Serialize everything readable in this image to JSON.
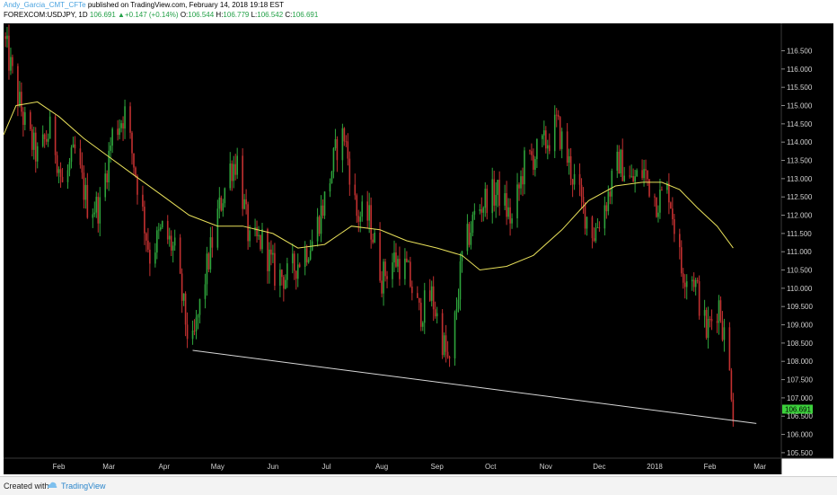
{
  "header": {
    "author": "Andy_Garcia_CMT_CFTe",
    "published": " published on TradingView.com, February 14, 2018 19:18 EST",
    "symbol": "FOREXCOM:USDJPY, 1D",
    "last": "106.691",
    "change": "+0.147 (+0.14%)",
    "o_label": "O:",
    "o_value": "106.544",
    "h_label": "H:",
    "h_value": "106.779",
    "l_label": "L:",
    "l_value": "106.542",
    "c_label": "C:",
    "c_value": "106.691"
  },
  "footer": {
    "created": "Created with",
    "brand": "TradingView"
  },
  "colors": {
    "background": "#000000",
    "up_candle": "#2ea43c",
    "down_candle": "#c23030",
    "moving_average": "#e8e05a",
    "trendline": "#d8d8d8",
    "price_tag": "#3cd13c"
  },
  "chart_data": {
    "type": "candlestick",
    "symbol": "USDJPY",
    "interval": "1D",
    "x_axis_labels": [
      "Feb",
      "Mar",
      "Apr",
      "May",
      "Jun",
      "Jul",
      "Aug",
      "Sep",
      "Oct",
      "Nov",
      "Dec",
      "2018",
      "Feb",
      "Mar"
    ],
    "y_axis_labels": [
      "116.500",
      "116.000",
      "115.500",
      "115.000",
      "114.500",
      "114.000",
      "113.500",
      "113.000",
      "112.500",
      "112.000",
      "111.500",
      "111.000",
      "110.500",
      "110.000",
      "109.500",
      "109.000",
      "108.500",
      "108.000",
      "107.500",
      "107.000",
      "106.500",
      "106.000",
      "105.500"
    ],
    "ylim": [
      105.35,
      117.25
    ],
    "last_price": "106.691",
    "close_path": [
      [
        "2017-01-01",
        116.9
      ],
      [
        "2017-01-07",
        115.6
      ],
      [
        "2017-01-14",
        114.3
      ],
      [
        "2017-01-20",
        113.6
      ],
      [
        "2017-01-28",
        114.4
      ],
      [
        "2017-02-03",
        112.8
      ],
      [
        "2017-02-10",
        113.7
      ],
      [
        "2017-02-17",
        112.3
      ],
      [
        "2017-02-24",
        112.2
      ],
      [
        "2017-03-03",
        114.2
      ],
      [
        "2017-03-10",
        114.8
      ],
      [
        "2017-03-17",
        112.9
      ],
      [
        "2017-03-24",
        110.9
      ],
      [
        "2017-03-31",
        111.6
      ],
      [
        "2017-04-07",
        111.0
      ],
      [
        "2017-04-14",
        108.8
      ],
      [
        "2017-04-17",
        108.4
      ],
      [
        "2017-04-24",
        110.3
      ],
      [
        "2017-05-01",
        112.0
      ],
      [
        "2017-05-08",
        113.3
      ],
      [
        "2017-05-12",
        113.5
      ],
      [
        "2017-05-19",
        111.2
      ],
      [
        "2017-05-26",
        111.3
      ],
      [
        "2017-06-02",
        110.4
      ],
      [
        "2017-06-09",
        110.3
      ],
      [
        "2017-06-16",
        110.8
      ],
      [
        "2017-06-23",
        111.3
      ],
      [
        "2017-06-30",
        112.4
      ],
      [
        "2017-07-07",
        113.9
      ],
      [
        "2017-07-11",
        114.2
      ],
      [
        "2017-07-18",
        112.0
      ],
      [
        "2017-07-25",
        111.9
      ],
      [
        "2017-08-01",
        110.3
      ],
      [
        "2017-08-08",
        110.8
      ],
      [
        "2017-08-15",
        110.5
      ],
      [
        "2017-08-22",
        109.3
      ],
      [
        "2017-08-29",
        109.8
      ],
      [
        "2017-09-08",
        107.8
      ],
      [
        "2017-09-15",
        110.8
      ],
      [
        "2017-09-22",
        112.0
      ],
      [
        "2017-09-29",
        112.5
      ],
      [
        "2017-10-06",
        112.6
      ],
      [
        "2017-10-13",
        111.8
      ],
      [
        "2017-10-20",
        113.4
      ],
      [
        "2017-10-27",
        113.7
      ],
      [
        "2017-11-03",
        114.1
      ],
      [
        "2017-11-07",
        114.5
      ],
      [
        "2017-11-14",
        113.4
      ],
      [
        "2017-11-21",
        112.3
      ],
      [
        "2017-11-28",
        111.5
      ],
      [
        "2017-12-05",
        112.4
      ],
      [
        "2017-12-12",
        113.5
      ],
      [
        "2017-12-19",
        112.9
      ],
      [
        "2017-12-26",
        113.2
      ],
      [
        "2018-01-02",
        112.4
      ],
      [
        "2018-01-09",
        112.7
      ],
      [
        "2018-01-16",
        110.5
      ],
      [
        "2018-01-23",
        110.3
      ],
      [
        "2018-01-30",
        108.8
      ],
      [
        "2018-02-06",
        109.6
      ],
      [
        "2018-02-09",
        108.7
      ],
      [
        "2018-02-13",
        107.3
      ],
      [
        "2018-02-14",
        106.7
      ]
    ],
    "moving_average": [
      [
        "2017-01-01",
        114.2
      ],
      [
        "2017-01-08",
        115.0
      ],
      [
        "2017-01-20",
        115.1
      ],
      [
        "2017-02-01",
        114.7
      ],
      [
        "2017-02-15",
        114.1
      ],
      [
        "2017-03-01",
        113.6
      ],
      [
        "2017-03-15",
        113.1
      ],
      [
        "2017-04-01",
        112.5
      ],
      [
        "2017-04-15",
        112.0
      ],
      [
        "2017-05-01",
        111.7
      ],
      [
        "2017-05-15",
        111.7
      ],
      [
        "2017-06-01",
        111.5
      ],
      [
        "2017-06-15",
        111.1
      ],
      [
        "2017-06-30",
        111.2
      ],
      [
        "2017-07-15",
        111.7
      ],
      [
        "2017-07-31",
        111.6
      ],
      [
        "2017-08-15",
        111.3
      ],
      [
        "2017-09-01",
        111.1
      ],
      [
        "2017-09-15",
        110.9
      ],
      [
        "2017-09-25",
        110.5
      ],
      [
        "2017-10-10",
        110.6
      ],
      [
        "2017-10-25",
        110.9
      ],
      [
        "2017-11-10",
        111.6
      ],
      [
        "2017-11-25",
        112.4
      ],
      [
        "2017-12-10",
        112.8
      ],
      [
        "2017-12-25",
        112.9
      ],
      [
        "2018-01-05",
        112.9
      ],
      [
        "2018-01-15",
        112.7
      ],
      [
        "2018-01-25",
        112.2
      ],
      [
        "2018-02-05",
        111.7
      ],
      [
        "2018-02-14",
        111.1
      ]
    ],
    "trendline": [
      [
        "2017-04-17",
        108.3
      ],
      [
        "2018-02-27",
        106.3
      ]
    ]
  }
}
